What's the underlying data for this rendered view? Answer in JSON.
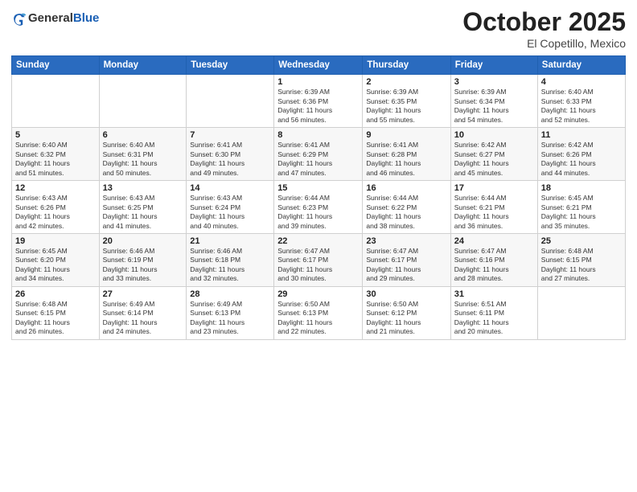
{
  "header": {
    "logo": {
      "general": "General",
      "blue": "Blue"
    },
    "title": "October 2025",
    "location": "El Copetillo, Mexico"
  },
  "weekdays": [
    "Sunday",
    "Monday",
    "Tuesday",
    "Wednesday",
    "Thursday",
    "Friday",
    "Saturday"
  ],
  "weeks": [
    [
      {
        "day": "",
        "info": ""
      },
      {
        "day": "",
        "info": ""
      },
      {
        "day": "",
        "info": ""
      },
      {
        "day": "1",
        "info": "Sunrise: 6:39 AM\nSunset: 6:36 PM\nDaylight: 11 hours and 56 minutes."
      },
      {
        "day": "2",
        "info": "Sunrise: 6:39 AM\nSunset: 6:35 PM\nDaylight: 11 hours and 55 minutes."
      },
      {
        "day": "3",
        "info": "Sunrise: 6:39 AM\nSunset: 6:34 PM\nDaylight: 11 hours and 54 minutes."
      },
      {
        "day": "4",
        "info": "Sunrise: 6:40 AM\nSunset: 6:33 PM\nDaylight: 11 hours and 52 minutes."
      }
    ],
    [
      {
        "day": "5",
        "info": "Sunrise: 6:40 AM\nSunset: 6:32 PM\nDaylight: 11 hours and 51 minutes."
      },
      {
        "day": "6",
        "info": "Sunrise: 6:40 AM\nSunset: 6:31 PM\nDaylight: 11 hours and 50 minutes."
      },
      {
        "day": "7",
        "info": "Sunrise: 6:41 AM\nSunset: 6:30 PM\nDaylight: 11 hours and 49 minutes."
      },
      {
        "day": "8",
        "info": "Sunrise: 6:41 AM\nSunset: 6:29 PM\nDaylight: 11 hours and 47 minutes."
      },
      {
        "day": "9",
        "info": "Sunrise: 6:41 AM\nSunset: 6:28 PM\nDaylight: 11 hours and 46 minutes."
      },
      {
        "day": "10",
        "info": "Sunrise: 6:42 AM\nSunset: 6:27 PM\nDaylight: 11 hours and 45 minutes."
      },
      {
        "day": "11",
        "info": "Sunrise: 6:42 AM\nSunset: 6:26 PM\nDaylight: 11 hours and 44 minutes."
      }
    ],
    [
      {
        "day": "12",
        "info": "Sunrise: 6:43 AM\nSunset: 6:26 PM\nDaylight: 11 hours and 42 minutes."
      },
      {
        "day": "13",
        "info": "Sunrise: 6:43 AM\nSunset: 6:25 PM\nDaylight: 11 hours and 41 minutes."
      },
      {
        "day": "14",
        "info": "Sunrise: 6:43 AM\nSunset: 6:24 PM\nDaylight: 11 hours and 40 minutes."
      },
      {
        "day": "15",
        "info": "Sunrise: 6:44 AM\nSunset: 6:23 PM\nDaylight: 11 hours and 39 minutes."
      },
      {
        "day": "16",
        "info": "Sunrise: 6:44 AM\nSunset: 6:22 PM\nDaylight: 11 hours and 38 minutes."
      },
      {
        "day": "17",
        "info": "Sunrise: 6:44 AM\nSunset: 6:21 PM\nDaylight: 11 hours and 36 minutes."
      },
      {
        "day": "18",
        "info": "Sunrise: 6:45 AM\nSunset: 6:21 PM\nDaylight: 11 hours and 35 minutes."
      }
    ],
    [
      {
        "day": "19",
        "info": "Sunrise: 6:45 AM\nSunset: 6:20 PM\nDaylight: 11 hours and 34 minutes."
      },
      {
        "day": "20",
        "info": "Sunrise: 6:46 AM\nSunset: 6:19 PM\nDaylight: 11 hours and 33 minutes."
      },
      {
        "day": "21",
        "info": "Sunrise: 6:46 AM\nSunset: 6:18 PM\nDaylight: 11 hours and 32 minutes."
      },
      {
        "day": "22",
        "info": "Sunrise: 6:47 AM\nSunset: 6:17 PM\nDaylight: 11 hours and 30 minutes."
      },
      {
        "day": "23",
        "info": "Sunrise: 6:47 AM\nSunset: 6:17 PM\nDaylight: 11 hours and 29 minutes."
      },
      {
        "day": "24",
        "info": "Sunrise: 6:47 AM\nSunset: 6:16 PM\nDaylight: 11 hours and 28 minutes."
      },
      {
        "day": "25",
        "info": "Sunrise: 6:48 AM\nSunset: 6:15 PM\nDaylight: 11 hours and 27 minutes."
      }
    ],
    [
      {
        "day": "26",
        "info": "Sunrise: 6:48 AM\nSunset: 6:15 PM\nDaylight: 11 hours and 26 minutes."
      },
      {
        "day": "27",
        "info": "Sunrise: 6:49 AM\nSunset: 6:14 PM\nDaylight: 11 hours and 24 minutes."
      },
      {
        "day": "28",
        "info": "Sunrise: 6:49 AM\nSunset: 6:13 PM\nDaylight: 11 hours and 23 minutes."
      },
      {
        "day": "29",
        "info": "Sunrise: 6:50 AM\nSunset: 6:13 PM\nDaylight: 11 hours and 22 minutes."
      },
      {
        "day": "30",
        "info": "Sunrise: 6:50 AM\nSunset: 6:12 PM\nDaylight: 11 hours and 21 minutes."
      },
      {
        "day": "31",
        "info": "Sunrise: 6:51 AM\nSunset: 6:11 PM\nDaylight: 11 hours and 20 minutes."
      },
      {
        "day": "",
        "info": ""
      }
    ]
  ]
}
